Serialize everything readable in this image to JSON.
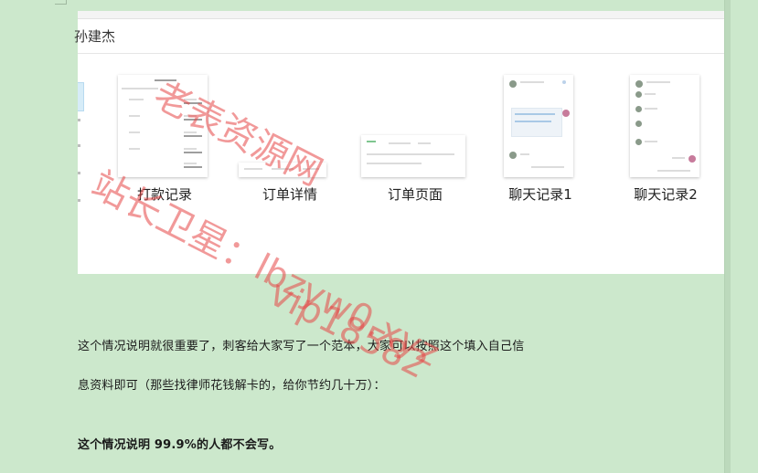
{
  "panel": {
    "title": "孙建杰",
    "thumbnails": [
      {
        "label": "打款记录"
      },
      {
        "label": "订单详情"
      },
      {
        "label": "订单页面"
      },
      {
        "label": "聊天记录1"
      },
      {
        "label": "聊天记录2"
      }
    ]
  },
  "body": {
    "line1": "这个情况说明就很重要了，刺客给大家写了一个范本，大家可以按照这个填入自己信",
    "line2": "息资料即可（那些找律师花钱解卡的，给你节约几十万）：",
    "line3": "这个情况说明 99.9%的人都不会写。"
  },
  "watermarks": {
    "line1": "老表资源网",
    "line2": "站长卫星：lbzyw0.xyz",
    "line3": "vip18582"
  }
}
